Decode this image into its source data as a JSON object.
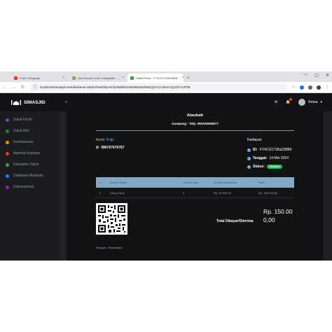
{
  "browser": {
    "tabs": [
      {
        "title": "Chat | Telegraph",
        "color": "#e53935",
        "active": false
      },
      {
        "title": "Jual Source Code Codeigniter - ...",
        "color": "#7cb342",
        "active": false
      },
      {
        "title": "Zakat Fitrah - FY4CD171Ba23BB...",
        "color": "#43a047",
        "active": true
      }
    ],
    "new_tab": "+",
    "controls": [
      "—",
      "▢",
      "✕"
    ],
    "url": "localhost/simasjid-main/kwitansi-zakat-fitrah/DDA6Yp3NzBhSG5tdWt2eEhMZQDY1AUhmi7Q1ZGYxZTlB"
  },
  "app": {
    "brand": "SIMASJID",
    "menu_toggle": "«",
    "user_name": "Ketua",
    "sidebar": [
      {
        "label": "Zakat Fitrah",
        "color": "#6f42c1"
      },
      {
        "label": "Zakat Mal",
        "color": "#2e7d32"
      },
      {
        "label": "Inventarisasi",
        "color": "#fb8c00"
      },
      {
        "label": "Agenda Kegiatan",
        "color": "#e53935"
      },
      {
        "label": "Kalkulator Zakat",
        "color": "#43a047"
      },
      {
        "label": "Database Mustahik",
        "color": "#1e88e5"
      },
      {
        "label": "Dokumentasi",
        "color": "#8e24aa"
      }
    ]
  },
  "receipt": {
    "org_name": "Ataubah",
    "org_address": "Gumpang - Telp: 082329085577",
    "donor_label": "Kerta: ",
    "donor_name": "Puijo",
    "phone": "096767676767",
    "kwitansi_title": "Kwitansi",
    "id_label": "ID:",
    "id_value": "FY4CD171Ba23BB9",
    "date_label": "Tanggal:",
    "date_value": "14 Mei 2024",
    "status_label": "Status:",
    "status_value": "Diterima",
    "table": {
      "headers": [
        "#",
        "Bentuk Zakat",
        "Jumlah Jiwa",
        "Jumlah Zakat/Jiwa",
        "Total"
      ],
      "rows": [
        [
          "1",
          "Uang Tunai",
          "3",
          "Rp. 50.000,00",
          "Rp. 150.000,00"
        ]
      ]
    },
    "total_label": "Total Dibayar/Diterima",
    "total_value": "Rp. 150.000,00",
    "officer": "Petugas : Bendahara"
  }
}
